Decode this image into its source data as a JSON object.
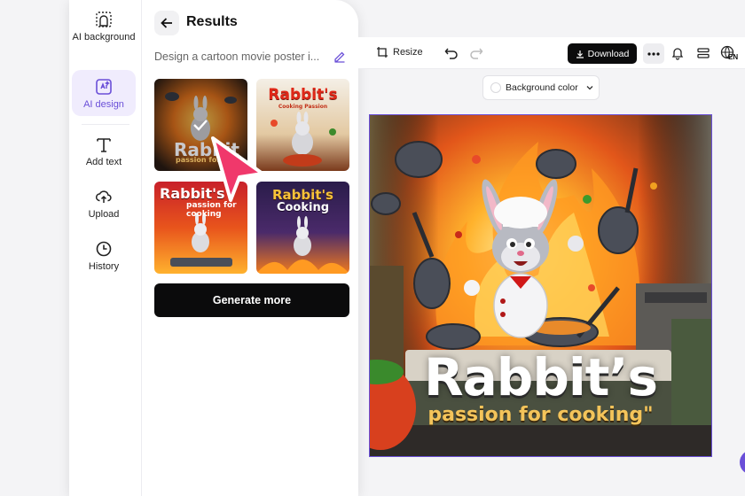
{
  "rail": {
    "items": [
      {
        "label": "AI background",
        "icon": "ai-background-icon",
        "active": false
      },
      {
        "label": "AI design",
        "icon": "ai-design-icon",
        "active": true
      },
      {
        "label": "Add text",
        "icon": "text-icon",
        "active": false
      },
      {
        "label": "Upload",
        "icon": "upload-cloud-icon",
        "active": false
      },
      {
        "label": "History",
        "icon": "clock-icon",
        "active": false
      }
    ]
  },
  "results": {
    "title": "Results",
    "prompt": "Design a cartoon movie poster i...",
    "thumbnails": [
      {
        "title": "Rabbit",
        "subtitle": "passion for c",
        "selected": true
      },
      {
        "title": "Rabbit's",
        "subtitle": "Cooking Passion",
        "selected": false
      },
      {
        "title": "Rabbit's",
        "subtitle": "passion for cooking",
        "selected": false
      },
      {
        "title": "Rabbit's",
        "subtitle": "Cooking",
        "selected": false
      }
    ],
    "generate_label": "Generate more"
  },
  "toolbar": {
    "resize_label": "Resize",
    "download_label": "Download",
    "lang_label": "EN"
  },
  "bg_color": {
    "label": "Background color"
  },
  "poster": {
    "title": "Rabbit’s",
    "subtitle": "passion for cooking\""
  },
  "colors": {
    "accent": "#6a4fd8",
    "cursor": "#f0386b",
    "primary_button": "#0b0b0c"
  }
}
